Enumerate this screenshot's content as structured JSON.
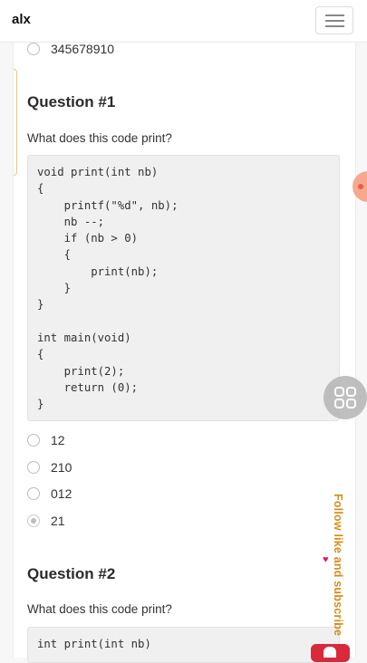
{
  "header": {
    "logo": "alx",
    "menu_icon": "hamburger-icon"
  },
  "previous_option": {
    "label": "345678910"
  },
  "question1": {
    "title": "Question #1",
    "prompt": "What does this code print?",
    "code": "void print(int nb)\n{\n    printf(\"%d\", nb);\n    nb --;\n    if (nb > 0)\n    {\n        print(nb);\n    }\n}\n\nint main(void)\n{\n    print(2);\n    return (0);\n}",
    "options": [
      {
        "label": "12",
        "selected": false
      },
      {
        "label": "210",
        "selected": false
      },
      {
        "label": "012",
        "selected": false
      },
      {
        "label": "21",
        "selected": true
      }
    ]
  },
  "question2": {
    "title": "Question #2",
    "prompt": "What does this code print?",
    "code": "int print(int nb)"
  },
  "overlay": {
    "vertical_caption": "Follow like and subscribe",
    "grid_button_icon": "grid-icon",
    "heart_icon": "heart-icon",
    "accent_color": "#d98b1a"
  }
}
